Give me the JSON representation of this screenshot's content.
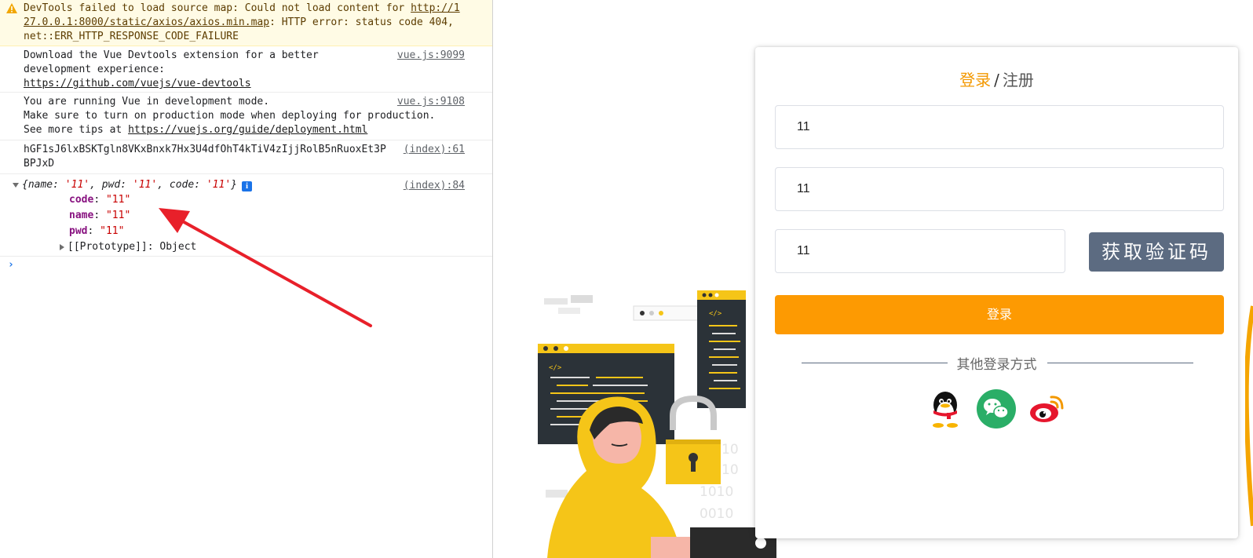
{
  "console": {
    "warning": {
      "text_a": "DevTools failed to load source map: Could not load content for ",
      "url": "http://127.0.0.1:8000/static/axios/axios.min.map",
      "text_b": ": HTTP error: status code 404, net::ERR_HTTP_RESPONSE_CODE_FAILURE"
    },
    "devtools_msg": {
      "text": "Download the Vue Devtools extension for a better development experience:",
      "url": "https://github.com/vuejs/vue-devtools",
      "source": "vue.js:9099"
    },
    "devmode_msg": {
      "text_a": "You are running Vue in development mode.",
      "text_b": "Make sure to turn on production mode when deploying for production.",
      "text_c": "See more tips at ",
      "url": "https://vuejs.org/guide/deployment.html",
      "source": "vue.js:9108"
    },
    "token_msg": {
      "text": "hGF1sJ6lxBSKTgln8VKxBnxk7Hx3U4dfOhT4kTiV4zIjjRolB5nRuoxEt3PBPJxD",
      "source": "(index):61"
    },
    "object_msg": {
      "source": "(index):84",
      "summary": {
        "open": "{",
        "k1": "name",
        "v1": "'11'",
        "k2": "pwd",
        "v2": "'11'",
        "k3": "code",
        "v3": "'11'",
        "close": "}"
      },
      "info_badge": "i",
      "properties": [
        {
          "key": "code",
          "value": "\"11\""
        },
        {
          "key": "name",
          "value": "\"11\""
        },
        {
          "key": "pwd",
          "value": "\"11\""
        }
      ],
      "prototype_label": "[[Prototype]]",
      "prototype_value": "Object"
    },
    "prompt_symbol": "›"
  },
  "login": {
    "tab_login": "登录",
    "tab_separator": "/",
    "tab_register": "注册",
    "username_value": "11",
    "password_value": "11",
    "code_value": "11",
    "get_code_button": "获取验证码",
    "login_button": "登录",
    "other_methods": "其他登录方式",
    "social_icons": [
      "qq-icon",
      "wechat-icon",
      "weibo-icon"
    ]
  },
  "colors": {
    "accent_orange": "#fd9a02",
    "code_button": "#5c6b81",
    "wechat_green": "#2aae67",
    "weibo_red": "#e6162d",
    "arrow_red": "#e8202a"
  }
}
